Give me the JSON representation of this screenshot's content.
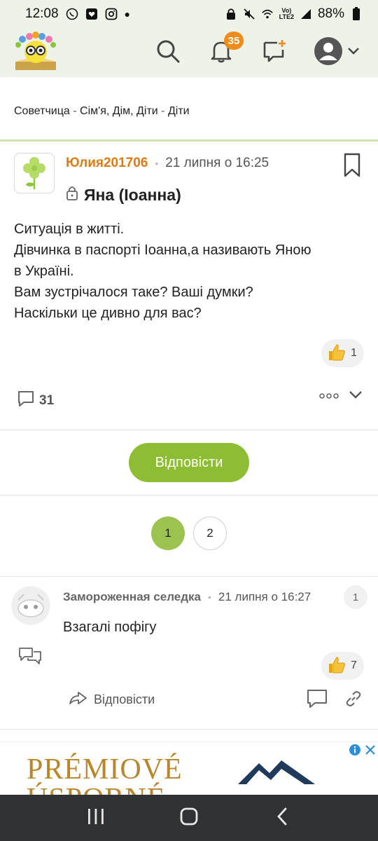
{
  "status_bar": {
    "time": "12:08",
    "battery": "88%",
    "network_top": "Vo)",
    "network_bottom": "LTE2"
  },
  "header": {
    "notifications_count": "35",
    "icons": [
      "search-icon",
      "bell-icon",
      "compose-icon",
      "user-avatar-icon",
      "chevron-down-icon"
    ]
  },
  "breadcrumb": {
    "items": [
      "Советчица",
      "Сім'я, Дім, Діти",
      "Діти"
    ],
    "separator": "-"
  },
  "post": {
    "author": "Юлия201706",
    "date": "21 липня о 16:25",
    "title": "Яна (Іоанна)",
    "body": [
      "Ситуація в житті.",
      "Дівчинка в паспорті Іоанна,а називають Яною",
      "в Україні.",
      "Вам зустрічалося таке? Ваші думки?",
      "Наскільки це дивно для вас?"
    ],
    "likes": "1",
    "comments_count": "31"
  },
  "reply_button": "Відповісти",
  "pagination": {
    "pages": [
      "1",
      "2"
    ],
    "current": "1"
  },
  "comment": {
    "author": "Замороженная селедка",
    "date": "21 липня о 16:27",
    "number": "1",
    "text": "Взагалі пофігу",
    "likes": "7",
    "reply_label": "Відповісти"
  },
  "ad": {
    "line1": "PRÉMIOVÉ",
    "line2": "ÚSPORNÉ"
  },
  "colors": {
    "header_bg": "#eef3e9",
    "accent_green": "#8dbd32",
    "author_orange": "#e07a14",
    "badge_orange": "#f08c1a"
  }
}
